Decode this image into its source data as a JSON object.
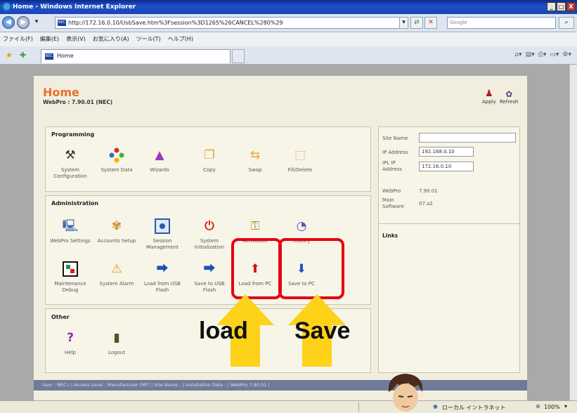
{
  "window": {
    "title": "Home - Windows Internet Explorer",
    "buttons": [
      "_",
      "□",
      "X"
    ]
  },
  "address": {
    "url": "http://172.16.0.10/UsbSave.htm%3Fsession%3D1265%26CANCEL%280%29",
    "favicon": "NEC",
    "search_placeholder": "Google"
  },
  "menu": [
    "ファイル(F)",
    "編集(E)",
    "表示(V)",
    "お気に入り(A)",
    "ツール(T)",
    "ヘルプ(H)"
  ],
  "tab": {
    "label": "Home",
    "favicon": "NEC"
  },
  "header": {
    "title": "Home",
    "subtitle": "WebPro : 7.90.01 (NEC)",
    "apply_label": "Apply",
    "refresh_label": "Refresh"
  },
  "programming": {
    "heading": "Programming",
    "items": [
      {
        "label": "System Configuration",
        "icon": "tools-icon"
      },
      {
        "label": "System Data",
        "icon": "dots-icon"
      },
      {
        "label": "Wizards",
        "icon": "wizard-icon"
      },
      {
        "label": "Copy",
        "icon": "copy-icon"
      },
      {
        "label": "Swap",
        "icon": "swap-icon"
      },
      {
        "label": "Fill/Delete",
        "icon": "fill-delete-icon"
      }
    ]
  },
  "administration": {
    "heading": "Administration",
    "row1": [
      {
        "label": "WebPro Settings",
        "icon": "monitor-icon"
      },
      {
        "label": "Accounts Setup",
        "icon": "accounts-icon"
      },
      {
        "label": "Session Management",
        "icon": "session-icon"
      },
      {
        "label": "System Initialization",
        "icon": "power-icon"
      },
      {
        "label": "Activation",
        "icon": "key-icon"
      },
      {
        "label": "History",
        "icon": "history-icon"
      }
    ],
    "row2": [
      {
        "label": "Maintenance Debug",
        "icon": "debug-icon"
      },
      {
        "label": "System Alarm",
        "icon": "alarm-icon"
      },
      {
        "label": "Load from USB Flash",
        "icon": "load-usb-icon"
      },
      {
        "label": "Save to USB Flash",
        "icon": "save-usb-icon"
      },
      {
        "label": "Load from PC",
        "icon": "load-pc-icon"
      },
      {
        "label": "Save to PC",
        "icon": "save-pc-icon"
      }
    ]
  },
  "other": {
    "heading": "Other",
    "items": [
      {
        "label": "Help",
        "icon": "help-icon"
      },
      {
        "label": "Logout",
        "icon": "logout-icon"
      }
    ]
  },
  "site": {
    "site_name_label": "Site Name",
    "site_name_value": "",
    "ip_label": "IP Address",
    "ip_value": "192.168.0.10",
    "ipl_label": "IPL IP Address",
    "ipl_value": "172.16.0.10",
    "webpro_label": "WebPro",
    "webpro_value": "7.90.01",
    "main_label": "Main Software",
    "main_value": "07.a2",
    "links_heading": "Links"
  },
  "page_status": "User : NEC-I | Access Level : Manufacturer (MF) | Site Name : | Installation Date : | WebPro 7.90.01 |",
  "ie_status": {
    "zone": "ローカル イントラネット",
    "zoom": "100%"
  },
  "annotations": {
    "load_label": "load",
    "save_label": "Save",
    "arrow_color": "#ffd21a",
    "highlight_color": "#e40012"
  }
}
